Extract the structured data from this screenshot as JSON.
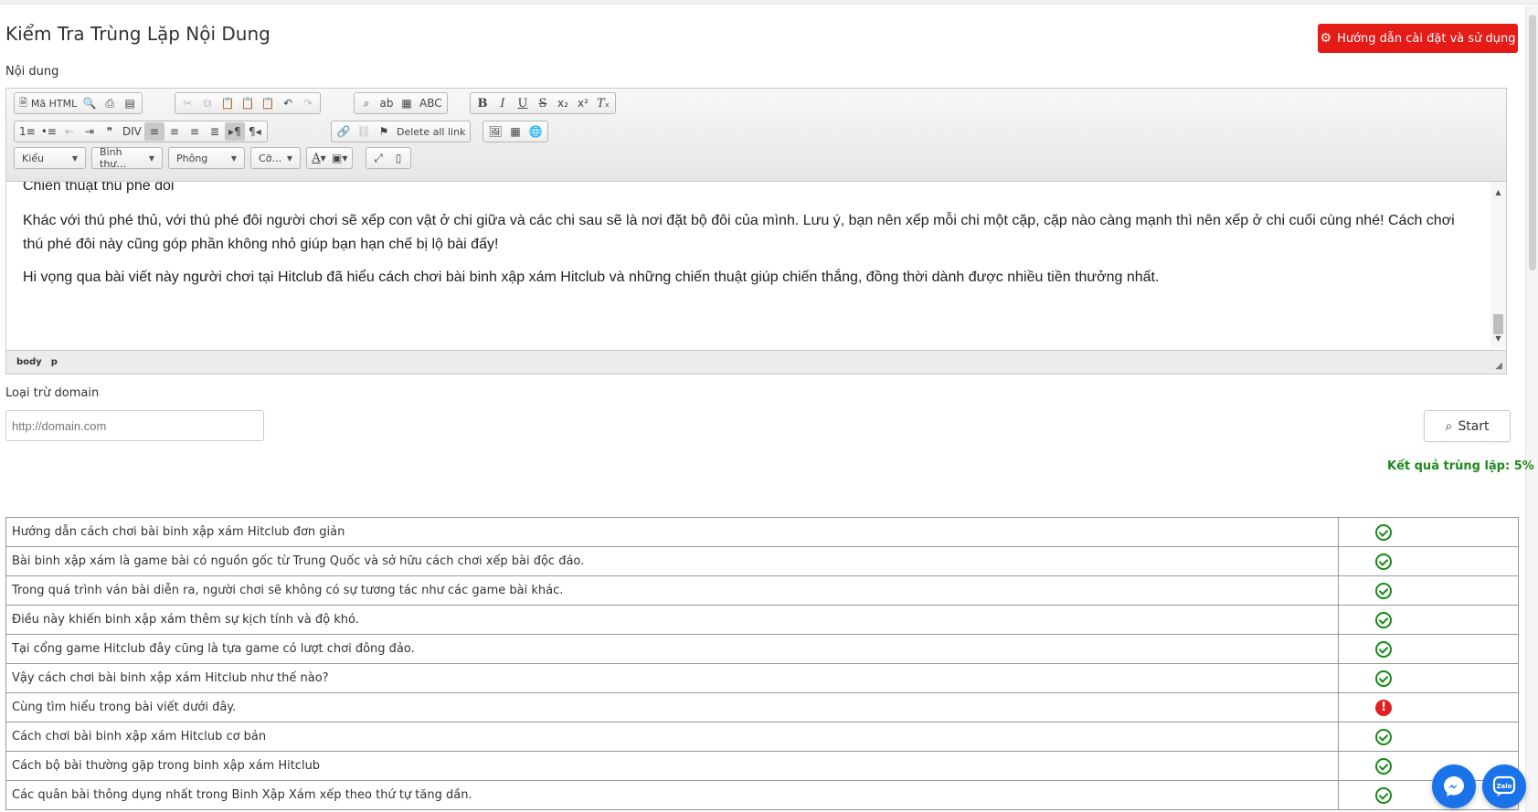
{
  "page": {
    "title": "Kiểm Tra Trùng Lặp Nội Dung",
    "guide_button": "Hướng dẫn cài đặt và sử dụng",
    "content_label": "Nội dung",
    "exclude_label": "Loại trừ domain",
    "domain_placeholder": "http://domain.com",
    "start_label": "Start",
    "result_text": "Kết quả trùng lặp: 5%"
  },
  "toolbar": {
    "source_label": "Mã HTML",
    "delete_links_label": "Delete all link",
    "combos": {
      "style": "Kiểu",
      "format": "Bình thư…",
      "font": "Phông",
      "size": "Cỡ…"
    },
    "icons": [
      "source-icon",
      "preview-icon",
      "print-icon",
      "templates-icon",
      "cut-icon",
      "copy-icon",
      "paste-icon",
      "paste-text-icon",
      "paste-word-icon",
      "undo-icon",
      "redo-icon",
      "find-icon",
      "replace-icon",
      "select-all-icon",
      "spellcheck-icon",
      "bold-icon",
      "italic-icon",
      "underline-icon",
      "strike-icon",
      "subscript-icon",
      "superscript-icon",
      "remove-format-icon",
      "numbered-list-icon",
      "bulleted-list-icon",
      "outdent-icon",
      "indent-icon",
      "blockquote-icon",
      "div-icon",
      "align-left-icon",
      "align-center-icon",
      "align-right-icon",
      "justify-icon",
      "ltr-icon",
      "rtl-icon",
      "link-icon",
      "unlink-icon",
      "anchor-icon",
      "image-icon",
      "table-icon",
      "iframe-icon",
      "text-color-icon",
      "bg-color-icon",
      "maximize-icon",
      "show-blocks-icon"
    ]
  },
  "editor": {
    "heading": "Chiến thuật thú phé đôi",
    "paragraphs": [
      "Khác với thú phé thủ, với thú phé đôi người chơi sẽ xếp con vật ở chi giữa và các chi sau sẽ là nơi đặt bộ đôi của mình. Lưu ý, bạn nên xếp mỗi chi một cặp, cặp nào càng mạnh thì nên xếp ở chi cuối cùng nhé! Cách chơi thú phé đôi này cũng góp phần không nhỏ giúp bạn hạn chế bị lộ bài đấy!",
      "Hi vọng qua bài viết này người chơi tại Hitclub đã hiểu cách chơi bài binh xập xám Hitclub và những chiến thuật giúp chiến thắng, đồng thời dành được nhiều tiền thưởng nhất."
    ],
    "path": [
      "body",
      "p"
    ]
  },
  "results": [
    {
      "text": "Hướng dẫn cách chơi bài binh xập xám Hitclub đơn giản",
      "status": "ok"
    },
    {
      "text": "Bài binh xập xám là game bài có nguồn gốc từ Trung Quốc và sở hữu cách chơi xếp bài độc đáo.",
      "status": "ok"
    },
    {
      "text": "Trong quá trình ván bài diễn ra, người chơi sẽ không có sự tương tác như các game bài khác.",
      "status": "ok"
    },
    {
      "text": "Điều này khiến binh xập xám thêm sự kịch tính và độ khó.",
      "status": "ok"
    },
    {
      "text": "Tại cổng game Hitclub đây cũng là tựa game có lượt chơi đông đảo.",
      "status": "ok"
    },
    {
      "text": "Vậy cách chơi bài binh xập xám Hitclub như thế nào?",
      "status": "ok"
    },
    {
      "text": "Cùng tìm hiểu trong bài viết dưới đây.",
      "status": "duplicate"
    },
    {
      "text": "Cách chơi bài binh xập xám Hitclub cơ bản",
      "status": "ok"
    },
    {
      "text": "Cách bộ bài thường gặp trong binh xập xám Hitclub",
      "status": "ok"
    },
    {
      "text": "Các quân bài thông dụng nhất trong Binh Xập Xám xếp theo thứ tự tăng dần.",
      "status": "ok"
    }
  ],
  "colors": {
    "accent_red": "#e41b17",
    "ok_green": "#178a17",
    "dup_red": "#e02020",
    "chat_blue": "#1a73e8"
  }
}
